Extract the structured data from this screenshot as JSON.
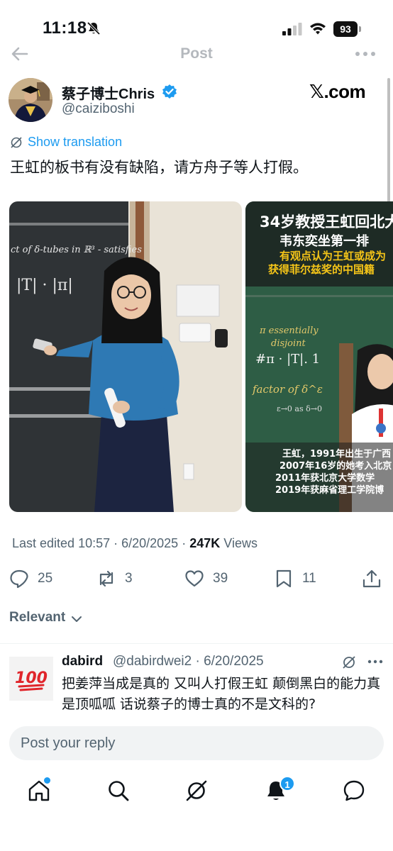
{
  "status_bar": {
    "time": "11:18",
    "battery": "93",
    "icons": [
      "bell-slash-icon",
      "signal-icon",
      "wifi-icon",
      "battery-icon"
    ]
  },
  "nav": {
    "title": "Post",
    "back_icon": "arrow-left-icon",
    "more_icon": "more-horizontal-icon"
  },
  "post": {
    "author_name": "蔡子博士Chris",
    "author_handle": "@caiziboshi",
    "verified": true,
    "source_badge": "𝕏.com",
    "show_translation": "Show translation",
    "text": "王虹的板书有没有缺陷，请方舟子等人打假。",
    "media": [
      {
        "board_text_line1": "ct of δ-tubes in ℝ³ - satisfies",
        "board_text_line2": "|T| · |π|"
      },
      {
        "headline_1": "34岁教授王虹回北大",
        "headline_2": "韦东奕坐第一排",
        "subline_1": "有观点认为王虹或成为",
        "subline_2": "获得菲尔兹奖的中国籍",
        "board_line1": "π essentially",
        "board_line2": "disjoint",
        "board_line3": "#π · |T|.   1",
        "board_line4": "factor of δ^ε",
        "board_line5": "ε→0 as δ→0",
        "caption_1": "王虹，1991年出生于广西",
        "caption_2": "2007年16岁的她考入北京",
        "caption_3": "2011年获北京大学数学",
        "caption_4": "2019年获麻省理工学院博"
      }
    ],
    "edited": "Last edited 10:57 · 6/20/2025",
    "separator": "·",
    "views_count": "247K",
    "views_label": "Views",
    "actions": {
      "replies": "25",
      "reposts": "3",
      "likes": "39",
      "bookmarks": "11"
    }
  },
  "sort": {
    "label": "Relevant"
  },
  "reply": {
    "avatar_emoji": "💯",
    "author": "dabird",
    "handle_date": "@dabirdwei2 · 6/20/2025",
    "text": "把姜萍当成是真的 又叫人打假王虹 颠倒黑白的能力真是顶呱呱 话说蔡子的博士真的不是文科的?"
  },
  "composer": {
    "placeholder": "Post your reply"
  },
  "tabbar": {
    "notifications_badge": "1",
    "items": [
      "home-icon",
      "search-icon",
      "grok-icon",
      "notifications-icon",
      "messages-icon"
    ]
  },
  "colors": {
    "accent": "#1d9bf0",
    "secondary_text": "#536471",
    "primary_text": "#0f1419",
    "chalkboard_dark": "#2f3336",
    "chalkboard_green": "#2e5d45"
  }
}
